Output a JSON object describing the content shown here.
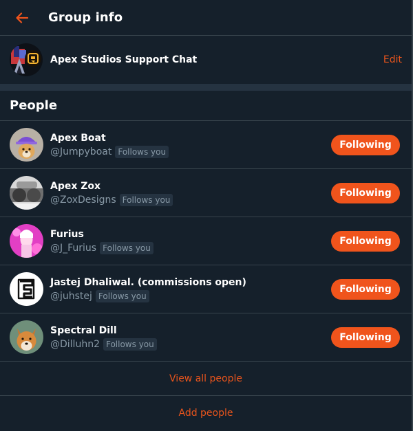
{
  "header": {
    "title": "Group info",
    "back_icon": "arrow-left-icon",
    "accent_color": "#f0541c"
  },
  "group": {
    "name": "Apex Studios Support Chat",
    "edit_label": "Edit"
  },
  "people_section": {
    "title": "People"
  },
  "people": [
    {
      "name": "Apex Boat",
      "handle": "@Jumpyboat",
      "badge": "Follows you",
      "button_label": "Following"
    },
    {
      "name": "Apex Zox",
      "handle": "@ZoxDesigns",
      "badge": "Follows you",
      "button_label": "Following"
    },
    {
      "name": "Furius",
      "handle": "@J_Furius",
      "badge": "Follows you",
      "button_label": "Following"
    },
    {
      "name": "Jastej Dhaliwal. (commissions open)",
      "handle": "@juhstej",
      "badge": "Follows you",
      "button_label": "Following"
    },
    {
      "name": "Spectral Dill",
      "handle": "@Dilluhn2",
      "badge": "Follows you",
      "button_label": "Following"
    }
  ],
  "footer": {
    "view_all_label": "View all people",
    "add_people_label": "Add people"
  }
}
